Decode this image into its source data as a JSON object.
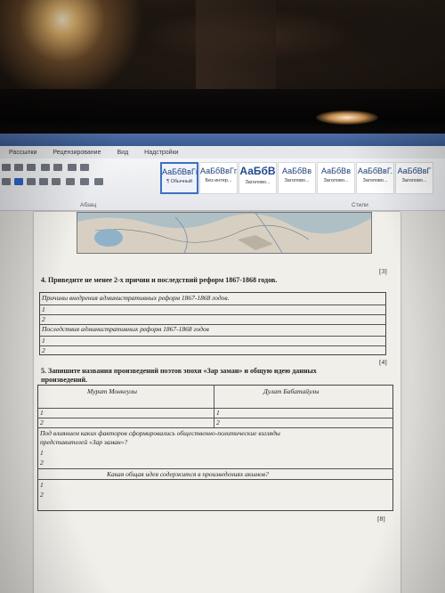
{
  "ribbon": {
    "tabs": [
      "Рассылки",
      "Рецензирование",
      "Вид",
      "Надстройки"
    ],
    "paragraph_group_label": "Абзац",
    "styles_group_label": "Стили",
    "styles": [
      {
        "sample": "АаБбВвГг,",
        "name": "¶ Обычный",
        "active": true
      },
      {
        "sample": "АаБбВвГг,",
        "name": "Без интер...",
        "active": false
      },
      {
        "sample": "АаБбВ",
        "name": "Заголово...",
        "active": false
      },
      {
        "sample": "АаБбВв",
        "name": "Заголово...",
        "active": false
      },
      {
        "sample": "АаБбВв",
        "name": "Заголово...",
        "active": false
      },
      {
        "sample": "АаБбВвГ.",
        "name": "Заголово...",
        "active": false
      },
      {
        "sample": "АаБбВвГ",
        "name": "Заголово...",
        "active": false
      }
    ]
  },
  "document": {
    "score_q3": "[3]",
    "q4": {
      "title": "4. Приведите не менее 2-х причин и последствий реформ 1867-1868 годов.",
      "causes_header": "Причины внедрения административных реформ 1867-1868 годов.",
      "effects_header": "Последствия административных реформ 1867-1868 годов",
      "n1": "1",
      "n2": "2",
      "score": "[4]"
    },
    "q5": {
      "title_line1": "5. Запишите названия произведений поэтов эпохи «Зар заман» и общую идею данных",
      "title_line2": "произведений.",
      "col1": "Мурат Монкеулы",
      "col2": "Дулат Бабатайулы",
      "n1": "1",
      "n2": "2",
      "question1_line1": "Под влиянием каких факторов сформировались общественно-политические взгляды",
      "question1_line2": "представителей «Зар заман»?",
      "question2": "Какая общая идея содержится в произведениях акынов?",
      "score": "[8]"
    }
  }
}
